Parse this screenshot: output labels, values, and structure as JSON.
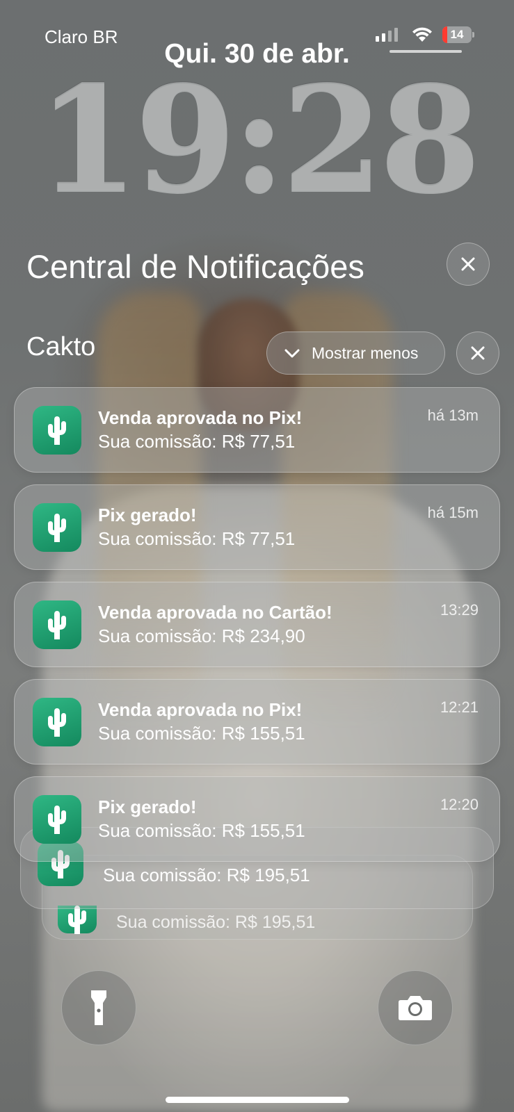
{
  "status_bar": {
    "carrier": "Claro BR",
    "battery_level": "14",
    "signal_bars_active": 2,
    "battery_color": "#ff3b30"
  },
  "lock_screen": {
    "date": "Qui. 30 de abr.",
    "time": "19:28"
  },
  "notification_center": {
    "title": "Central de Notificações",
    "close_icon": "close-icon"
  },
  "group": {
    "app_name": "Cakto",
    "toggle_label": "Mostrar menos",
    "app_icon": "cactus-icon",
    "accent_color": "#1fa06f"
  },
  "notifications": [
    {
      "title": "Venda aprovada no Pix!",
      "body": "Sua comissão: R$ 77,51",
      "time": "há 13m"
    },
    {
      "title": "Pix gerado!",
      "body": "Sua comissão: R$ 77,51",
      "time": "há 15m"
    },
    {
      "title": "Venda aprovada no Cartão!",
      "body": "Sua comissão: R$ 234,90",
      "time": "13:29"
    },
    {
      "title": "Venda aprovada no Pix!",
      "body": "Sua comissão: R$ 155,51",
      "time": "12:21"
    },
    {
      "title": "Pix gerado!",
      "body": "Sua comissão: R$ 155,51",
      "time": "12:20"
    }
  ],
  "stacked": [
    {
      "body": "Sua comissão: R$ 195,51"
    },
    {
      "body": "Sua comissão: R$ 195,51"
    }
  ],
  "quick_actions": {
    "left_icon": "flashlight-icon",
    "right_icon": "camera-icon"
  }
}
